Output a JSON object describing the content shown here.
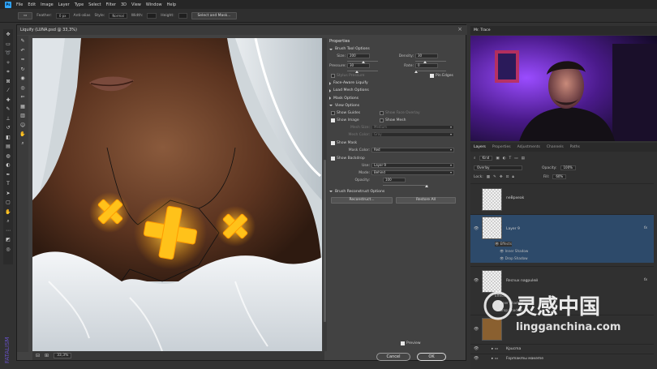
{
  "menubar": {
    "app_icon": "Ps",
    "items": [
      "File",
      "Edit",
      "Image",
      "Layer",
      "Type",
      "Select",
      "Filter",
      "3D",
      "View",
      "Window",
      "Help"
    ]
  },
  "options_bar": {
    "feather_label": "Feather:",
    "feather_value": "0 px",
    "antialias_label": "Anti-alias",
    "style_label": "Style:",
    "style_value": "Normal",
    "width_label": "Width:",
    "height_label": "Height:",
    "select_mask_button": "Select and Mask..."
  },
  "liquify": {
    "title": "Liquify (LUNA.psd @ 33,3%)",
    "zoom_value": "33,3%",
    "properties": {
      "header": "Properties",
      "brush_tool_options": "Brush Tool Options",
      "size_label": "Size:",
      "size_value": "200",
      "density_label": "Density:",
      "density_value": "30",
      "pressure_label": "Pressure:",
      "pressure_value": "30",
      "rate_label": "Rate:",
      "rate_value": "0",
      "stylus_pressure": "Stylus Pressure",
      "pin_edges": "Pin Edges",
      "face_aware": "Face-Aware Liquify",
      "load_mesh": "Load Mesh Options",
      "mask_options": "Mask Options",
      "view_options": "View Options",
      "show_guides": "Show Guides",
      "show_face_overlay": "Show Face Overlay",
      "show_image": "Show Image",
      "show_mesh": "Show Mesh",
      "mesh_size_label": "Mesh Size:",
      "mesh_size_value": "Medium",
      "mesh_color_label": "Mesh Color:",
      "mesh_color_value": "Gray",
      "show_mask": "Show Mask",
      "mask_color_label": "Mask Color:",
      "mask_color_value": "Red",
      "show_backdrop": "Show Backdrop",
      "use_label": "Use:",
      "use_value": "Layer 9",
      "mode_label": "Mode:",
      "mode_value": "Behind",
      "opacity_label": "Opacity:",
      "opacity_value": "100",
      "brush_reconstruct": "Brush Reconstruct Options",
      "reconstruct_button": "Reconstruct...",
      "restore_all_button": "Restore All",
      "preview_label": "Preview",
      "cancel_button": "Cancel",
      "ok_button": "OK"
    }
  },
  "stream": {
    "title": "Mr. Trace"
  },
  "layers_panel": {
    "tabs": [
      "Layers",
      "Properties",
      "Adjustments",
      "Channels",
      "Paths"
    ],
    "kind_label": "Kind",
    "blend_mode": "Overlay",
    "opacity_label": "Opacity:",
    "opacity_value": "100%",
    "lock_label": "Lock:",
    "fill_label": "Fill:",
    "fill_value": "60%",
    "layers": [
      {
        "name": "neBpxeak"
      },
      {
        "name": "Layer 9",
        "fx": "fx",
        "effects_label": "Effects",
        "effects": [
          "Inner Shadow",
          "Drop Shadow"
        ]
      },
      {
        "name": "Recnux nagpuleй",
        "fx": "fx"
      },
      {
        "name": "Kpucma"
      },
      {
        "name": "Kpucmы"
      },
      {
        "name": "Fopmaкmы макeme"
      }
    ],
    "mid_effects": [
      "Effects",
      "Inner Shadow",
      "Drop Shadow"
    ]
  },
  "overlay": {
    "watermark_cn": "灵感中国",
    "watermark_url": "lingganchina.com",
    "side_brand": "FATALISM"
  },
  "colors": {
    "accent_selection": "#2d4a6a",
    "glow_yellow": "#ffc21a",
    "purple_light": "#7a3cff"
  }
}
